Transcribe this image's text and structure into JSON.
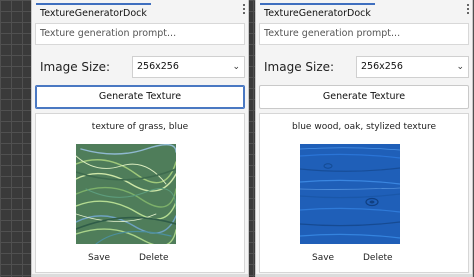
{
  "panels": [
    {
      "tab_title": "TextureGeneratorDock",
      "prompt_placeholder": "Texture generation prompt...",
      "size_label": "Image Size:",
      "size_value": "256x256",
      "generate_label": "Generate Texture",
      "texture_caption": "texture of grass, blue",
      "save_label": "Save",
      "delete_label": "Delete"
    },
    {
      "tab_title": "TextureGeneratorDock",
      "prompt_placeholder": "Texture generation prompt...",
      "size_label": "Image Size:",
      "size_value": "256x256",
      "generate_label": "Generate Texture",
      "texture_caption": "blue wood, oak, stylized texture",
      "save_label": "Save",
      "delete_label": "Delete"
    }
  ],
  "icons": {
    "menu": "kebab-menu-icon",
    "dropdown": "chevron-down-icon"
  },
  "colors": {
    "tab_accent": "#3f6fbf",
    "focus_border": "#4a78c2",
    "canvas_grid": "#505050"
  }
}
